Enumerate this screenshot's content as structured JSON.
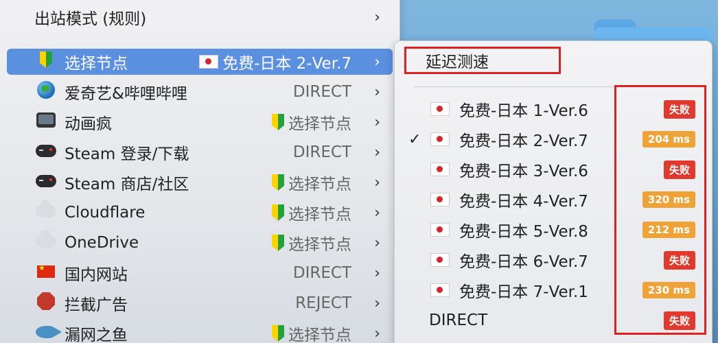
{
  "menu": {
    "header": {
      "label": "出站模式 (规则)"
    },
    "items": [
      {
        "label": "选择节点",
        "value": "免费-日本 2-Ver.7",
        "icon": "beginner-shield-icon",
        "value_icon": "japan-flag-icon",
        "selected": true
      },
      {
        "label": "爱奇艺&哔哩哔哩",
        "value": "DIRECT",
        "icon": "globe-icon"
      },
      {
        "label": "动画疯",
        "value": "选择节点",
        "icon": "tv-icon",
        "value_icon": "beginner-shield-icon"
      },
      {
        "label": "Steam 登录/下载",
        "value": "DIRECT",
        "icon": "gamepad-icon"
      },
      {
        "label": "Steam 商店/社区",
        "value": "选择节点",
        "icon": "gamepad-icon",
        "value_icon": "beginner-shield-icon"
      },
      {
        "label": "Cloudflare",
        "value": "选择节点",
        "icon": "cloud-lightning-icon",
        "value_icon": "beginner-shield-icon"
      },
      {
        "label": "OneDrive",
        "value": "选择节点",
        "icon": "cloud-icon",
        "value_icon": "beginner-shield-icon"
      },
      {
        "label": "国内网站",
        "value": "DIRECT",
        "icon": "china-flag-icon"
      },
      {
        "label": "拦截广告",
        "value": "REJECT",
        "icon": "stop-sign-icon"
      },
      {
        "label": "漏网之鱼",
        "value": "选择节点",
        "icon": "fish-icon",
        "value_icon": "beginner-shield-icon"
      }
    ]
  },
  "submenu": {
    "latency_test": "延迟测速",
    "nodes": [
      {
        "name": "免费-日本 1-Ver.6",
        "status": "失败",
        "checked": false
      },
      {
        "name": "免费-日本 2-Ver.7",
        "status": "204 ms",
        "checked": true
      },
      {
        "name": "免费-日本 3-Ver.6",
        "status": "失败",
        "checked": false
      },
      {
        "name": "免费-日本 4-Ver.7",
        "status": "320 ms",
        "checked": false
      },
      {
        "name": "免费-日本 5-Ver.8",
        "status": "212 ms",
        "checked": false
      },
      {
        "name": "免费-日本 6-Ver.7",
        "status": "失败",
        "checked": false
      },
      {
        "name": "免费-日本 7-Ver.1",
        "status": "230 ms",
        "checked": false
      }
    ],
    "direct": {
      "name": "DIRECT",
      "status": "失败"
    },
    "check_mark": "✓"
  },
  "colors": {
    "selected_row": "#5b8fe0",
    "fail_badge": "#e03a2f",
    "ok_badge": "#efa236",
    "highlight_box": "#e02020"
  }
}
